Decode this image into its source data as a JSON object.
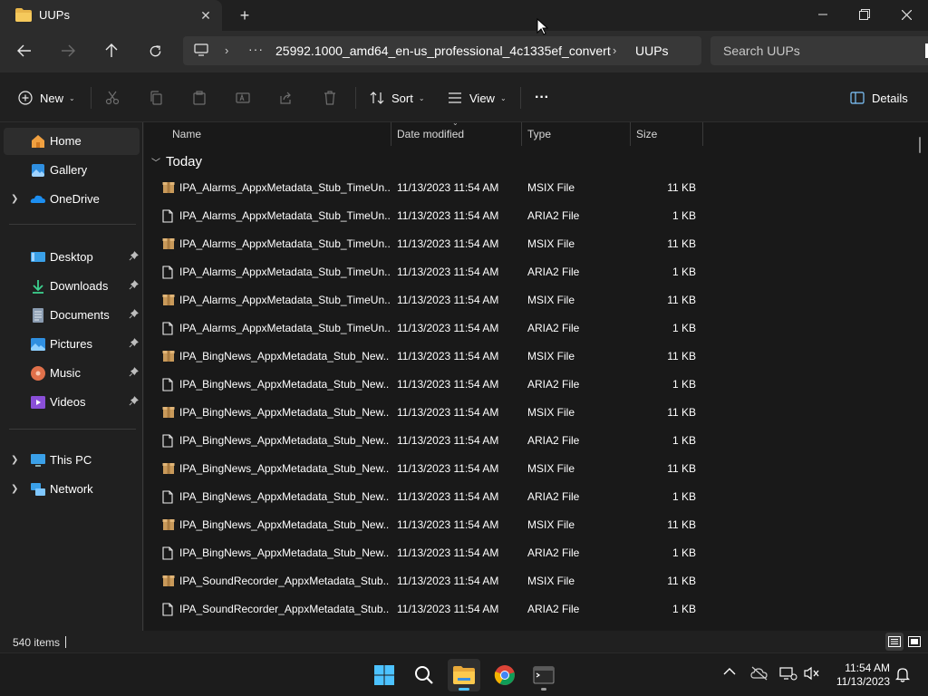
{
  "window": {
    "tab_title": "UUPs",
    "tab_close": "✕",
    "new_tab": "+"
  },
  "address": {
    "ellipsis": "···",
    "crumbs": [
      "25992.1000_amd64_en-us_professional_4c1335ef_convert",
      "UUPs"
    ],
    "search_placeholder": "Search UUPs"
  },
  "command_bar": {
    "new_label": "New",
    "sort_label": "Sort",
    "view_label": "View",
    "more_label": "···",
    "details_label": "Details"
  },
  "sidebar": {
    "items": [
      {
        "label": "Home",
        "icon": "home-icon",
        "selected": true
      },
      {
        "label": "Gallery",
        "icon": "gallery-icon"
      },
      {
        "label": "OneDrive",
        "icon": "onedrive-icon",
        "expandable": true
      },
      {
        "label": "Desktop",
        "icon": "desktop-icon",
        "pinned": true
      },
      {
        "label": "Downloads",
        "icon": "downloads-icon",
        "pinned": true
      },
      {
        "label": "Documents",
        "icon": "documents-icon",
        "pinned": true
      },
      {
        "label": "Pictures",
        "icon": "pictures-icon",
        "pinned": true
      },
      {
        "label": "Music",
        "icon": "music-icon",
        "pinned": true
      },
      {
        "label": "Videos",
        "icon": "videos-icon",
        "pinned": true
      },
      {
        "label": "This PC",
        "icon": "this-pc-icon",
        "expandable": true
      },
      {
        "label": "Network",
        "icon": "network-icon",
        "expandable": true
      }
    ]
  },
  "columns": {
    "name": "Name",
    "date": "Date modified",
    "type": "Type",
    "size": "Size"
  },
  "group": {
    "label": "Today"
  },
  "files": [
    {
      "name": "IPA_Alarms_AppxMetadata_Stub_TimeUn...",
      "date": "11/13/2023 11:54 AM",
      "type": "MSIX File",
      "size": "11 KB",
      "icon": "package-icon"
    },
    {
      "name": "IPA_Alarms_AppxMetadata_Stub_TimeUn...",
      "date": "11/13/2023 11:54 AM",
      "type": "ARIA2 File",
      "size": "1 KB",
      "icon": "file-icon"
    },
    {
      "name": "IPA_Alarms_AppxMetadata_Stub_TimeUn...",
      "date": "11/13/2023 11:54 AM",
      "type": "MSIX File",
      "size": "11 KB",
      "icon": "package-icon"
    },
    {
      "name": "IPA_Alarms_AppxMetadata_Stub_TimeUn...",
      "date": "11/13/2023 11:54 AM",
      "type": "ARIA2 File",
      "size": "1 KB",
      "icon": "file-icon"
    },
    {
      "name": "IPA_Alarms_AppxMetadata_Stub_TimeUn...",
      "date": "11/13/2023 11:54 AM",
      "type": "MSIX File",
      "size": "11 KB",
      "icon": "package-icon"
    },
    {
      "name": "IPA_Alarms_AppxMetadata_Stub_TimeUn...",
      "date": "11/13/2023 11:54 AM",
      "type": "ARIA2 File",
      "size": "1 KB",
      "icon": "file-icon"
    },
    {
      "name": "IPA_BingNews_AppxMetadata_Stub_New...",
      "date": "11/13/2023 11:54 AM",
      "type": "MSIX File",
      "size": "11 KB",
      "icon": "package-icon"
    },
    {
      "name": "IPA_BingNews_AppxMetadata_Stub_New...",
      "date": "11/13/2023 11:54 AM",
      "type": "ARIA2 File",
      "size": "1 KB",
      "icon": "file-icon"
    },
    {
      "name": "IPA_BingNews_AppxMetadata_Stub_New...",
      "date": "11/13/2023 11:54 AM",
      "type": "MSIX File",
      "size": "11 KB",
      "icon": "package-icon"
    },
    {
      "name": "IPA_BingNews_AppxMetadata_Stub_New...",
      "date": "11/13/2023 11:54 AM",
      "type": "ARIA2 File",
      "size": "1 KB",
      "icon": "file-icon"
    },
    {
      "name": "IPA_BingNews_AppxMetadata_Stub_New...",
      "date": "11/13/2023 11:54 AM",
      "type": "MSIX File",
      "size": "11 KB",
      "icon": "package-icon"
    },
    {
      "name": "IPA_BingNews_AppxMetadata_Stub_New...",
      "date": "11/13/2023 11:54 AM",
      "type": "ARIA2 File",
      "size": "1 KB",
      "icon": "file-icon"
    },
    {
      "name": "IPA_BingNews_AppxMetadata_Stub_New...",
      "date": "11/13/2023 11:54 AM",
      "type": "MSIX File",
      "size": "11 KB",
      "icon": "package-icon"
    },
    {
      "name": "IPA_BingNews_AppxMetadata_Stub_New...",
      "date": "11/13/2023 11:54 AM",
      "type": "ARIA2 File",
      "size": "1 KB",
      "icon": "file-icon"
    },
    {
      "name": "IPA_SoundRecorder_AppxMetadata_Stub...",
      "date": "11/13/2023 11:54 AM",
      "type": "MSIX File",
      "size": "11 KB",
      "icon": "package-icon"
    },
    {
      "name": "IPA_SoundRecorder_AppxMetadata_Stub...",
      "date": "11/13/2023 11:54 AM",
      "type": "ARIA2 File",
      "size": "1 KB",
      "icon": "file-icon"
    }
  ],
  "status": {
    "item_count": "540 items"
  },
  "taskbar": {
    "clock_time": "11:54 AM",
    "clock_date": "11/13/2023",
    "pinned": [
      "windows-start-icon",
      "search-icon",
      "file-explorer-icon",
      "chrome-icon",
      "terminal-icon"
    ]
  },
  "colors": {
    "accent": "#4cc2ff",
    "folder": "#e8b54a",
    "package": "#c99a5a"
  }
}
